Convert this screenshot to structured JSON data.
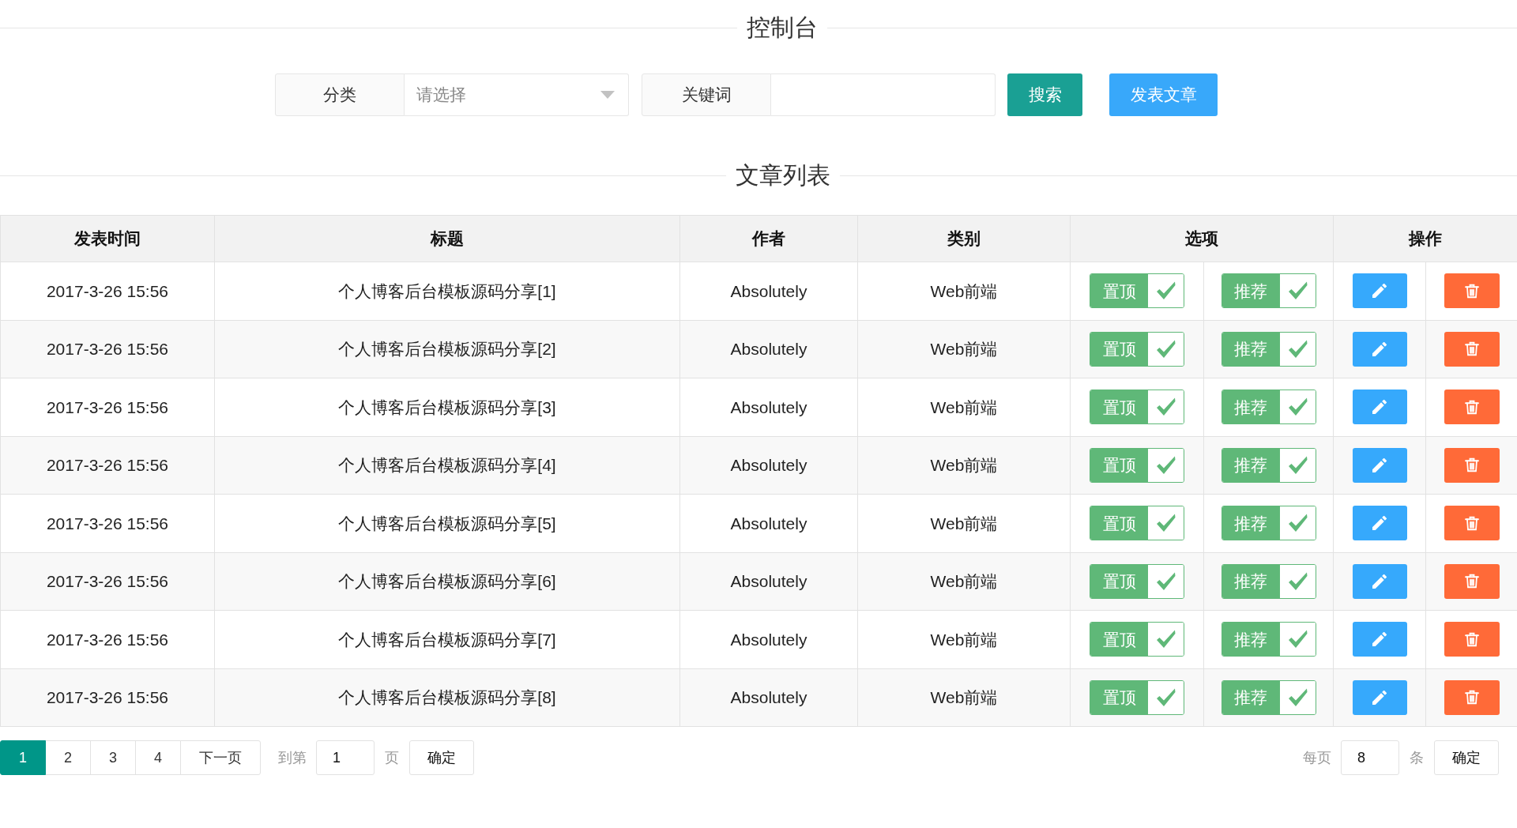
{
  "console": {
    "title": "控制台",
    "fields": [
      {
        "kind": "select",
        "label": "分类",
        "placeholder": "请选择"
      },
      {
        "kind": "text",
        "label": "关键词"
      }
    ],
    "buttons": [
      {
        "kind": "search",
        "label": "搜索"
      },
      {
        "kind": "publish",
        "label": "发表文章"
      }
    ]
  },
  "article_list": {
    "title": "文章列表",
    "columns": [
      {
        "kind": "text",
        "label": "发表时间"
      },
      {
        "kind": "text",
        "label": "标题"
      },
      {
        "kind": "text",
        "label": "作者"
      },
      {
        "kind": "text",
        "label": "类别"
      },
      {
        "kind": "options",
        "label": "选项"
      },
      {
        "kind": "actions",
        "label": "操作"
      }
    ],
    "rows": [
      {
        "time": "2017-3-26 15:56",
        "title": "个人博客后台模板源码分享[1]",
        "author": "Absolutely",
        "category": "Web前端",
        "options": [
          {
            "label": "置顶",
            "checked": true
          },
          {
            "label": "推荐",
            "checked": true
          }
        ]
      },
      {
        "time": "2017-3-26 15:56",
        "title": "个人博客后台模板源码分享[2]",
        "author": "Absolutely",
        "category": "Web前端",
        "options": [
          {
            "label": "置顶",
            "checked": true
          },
          {
            "label": "推荐",
            "checked": true
          }
        ]
      },
      {
        "time": "2017-3-26 15:56",
        "title": "个人博客后台模板源码分享[3]",
        "author": "Absolutely",
        "category": "Web前端",
        "options": [
          {
            "label": "置顶",
            "checked": true
          },
          {
            "label": "推荐",
            "checked": true
          }
        ]
      },
      {
        "time": "2017-3-26 15:56",
        "title": "个人博客后台模板源码分享[4]",
        "author": "Absolutely",
        "category": "Web前端",
        "options": [
          {
            "label": "置顶",
            "checked": true
          },
          {
            "label": "推荐",
            "checked": true
          }
        ]
      },
      {
        "time": "2017-3-26 15:56",
        "title": "个人博客后台模板源码分享[5]",
        "author": "Absolutely",
        "category": "Web前端",
        "options": [
          {
            "label": "置顶",
            "checked": true
          },
          {
            "label": "推荐",
            "checked": true
          }
        ]
      },
      {
        "time": "2017-3-26 15:56",
        "title": "个人博客后台模板源码分享[6]",
        "author": "Absolutely",
        "category": "Web前端",
        "options": [
          {
            "label": "置顶",
            "checked": true
          },
          {
            "label": "推荐",
            "checked": true
          }
        ]
      },
      {
        "time": "2017-3-26 15:56",
        "title": "个人博客后台模板源码分享[7]",
        "author": "Absolutely",
        "category": "Web前端",
        "options": [
          {
            "label": "置顶",
            "checked": true
          },
          {
            "label": "推荐",
            "checked": true
          }
        ]
      },
      {
        "time": "2017-3-26 15:56",
        "title": "个人博客后台模板源码分享[8]",
        "author": "Absolutely",
        "category": "Web前端",
        "options": [
          {
            "label": "置顶",
            "checked": true
          },
          {
            "label": "推荐",
            "checked": true
          }
        ]
      }
    ]
  },
  "pagination": {
    "pages": [
      {
        "label": "1",
        "selected": true
      },
      {
        "label": "2",
        "selected": false
      },
      {
        "label": "3",
        "selected": false
      },
      {
        "label": "4",
        "selected": false
      }
    ],
    "next": "下一页",
    "goto": {
      "label": "到第",
      "value": "1",
      "unit": "页",
      "confirm": "确定"
    },
    "page_size": {
      "label": "每页",
      "value": "8",
      "unit": "条",
      "confirm": "确定"
    }
  }
}
